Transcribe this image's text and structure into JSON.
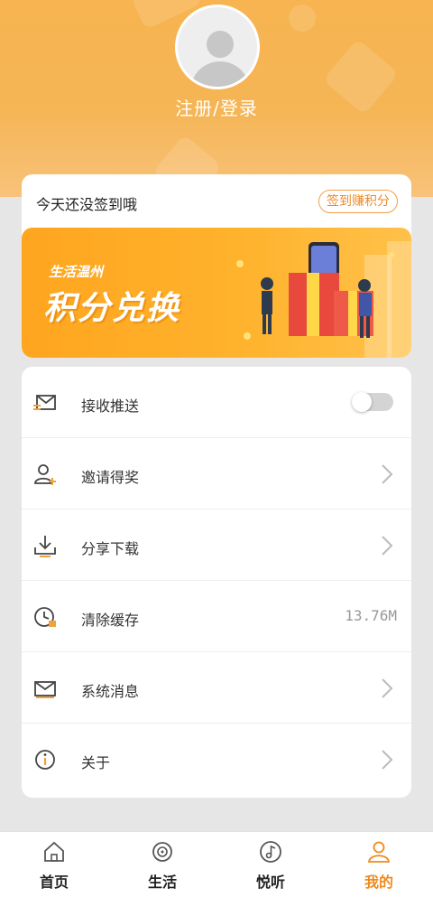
{
  "header": {
    "login_label": "注册/登录",
    "bg_color": "#f7b450"
  },
  "checkin": {
    "prompt": "今天还没签到哦",
    "button_label": "签到赚积分",
    "accent": "#ec8b2a"
  },
  "banner": {
    "subtitle": "生活温州",
    "title": "积分兑换"
  },
  "settings": [
    {
      "label": "接收推送",
      "icon": "envelope-push-icon",
      "control": "toggle",
      "toggle_on": false
    },
    {
      "label": "邀请得奖",
      "icon": "add-user-icon",
      "control": "chevron"
    },
    {
      "label": "分享下载",
      "icon": "download-icon",
      "control": "chevron"
    },
    {
      "label": "清除缓存",
      "icon": "clock-clear-icon",
      "control": "value",
      "value": "13.76M"
    },
    {
      "label": "系统消息",
      "icon": "mail-icon",
      "control": "chevron"
    },
    {
      "label": "关于",
      "icon": "info-icon",
      "control": "chevron"
    }
  ],
  "tabbar": [
    {
      "label": "首页",
      "icon": "home-icon",
      "active": false
    },
    {
      "label": "生活",
      "icon": "disc-icon",
      "active": false
    },
    {
      "label": "悦听",
      "icon": "music-icon",
      "active": false
    },
    {
      "label": "我的",
      "icon": "person-icon",
      "active": true
    }
  ],
  "colors": {
    "active_tab": "#ef8a1e",
    "icon": "#444444",
    "icon_accent": "#f2a23a"
  }
}
